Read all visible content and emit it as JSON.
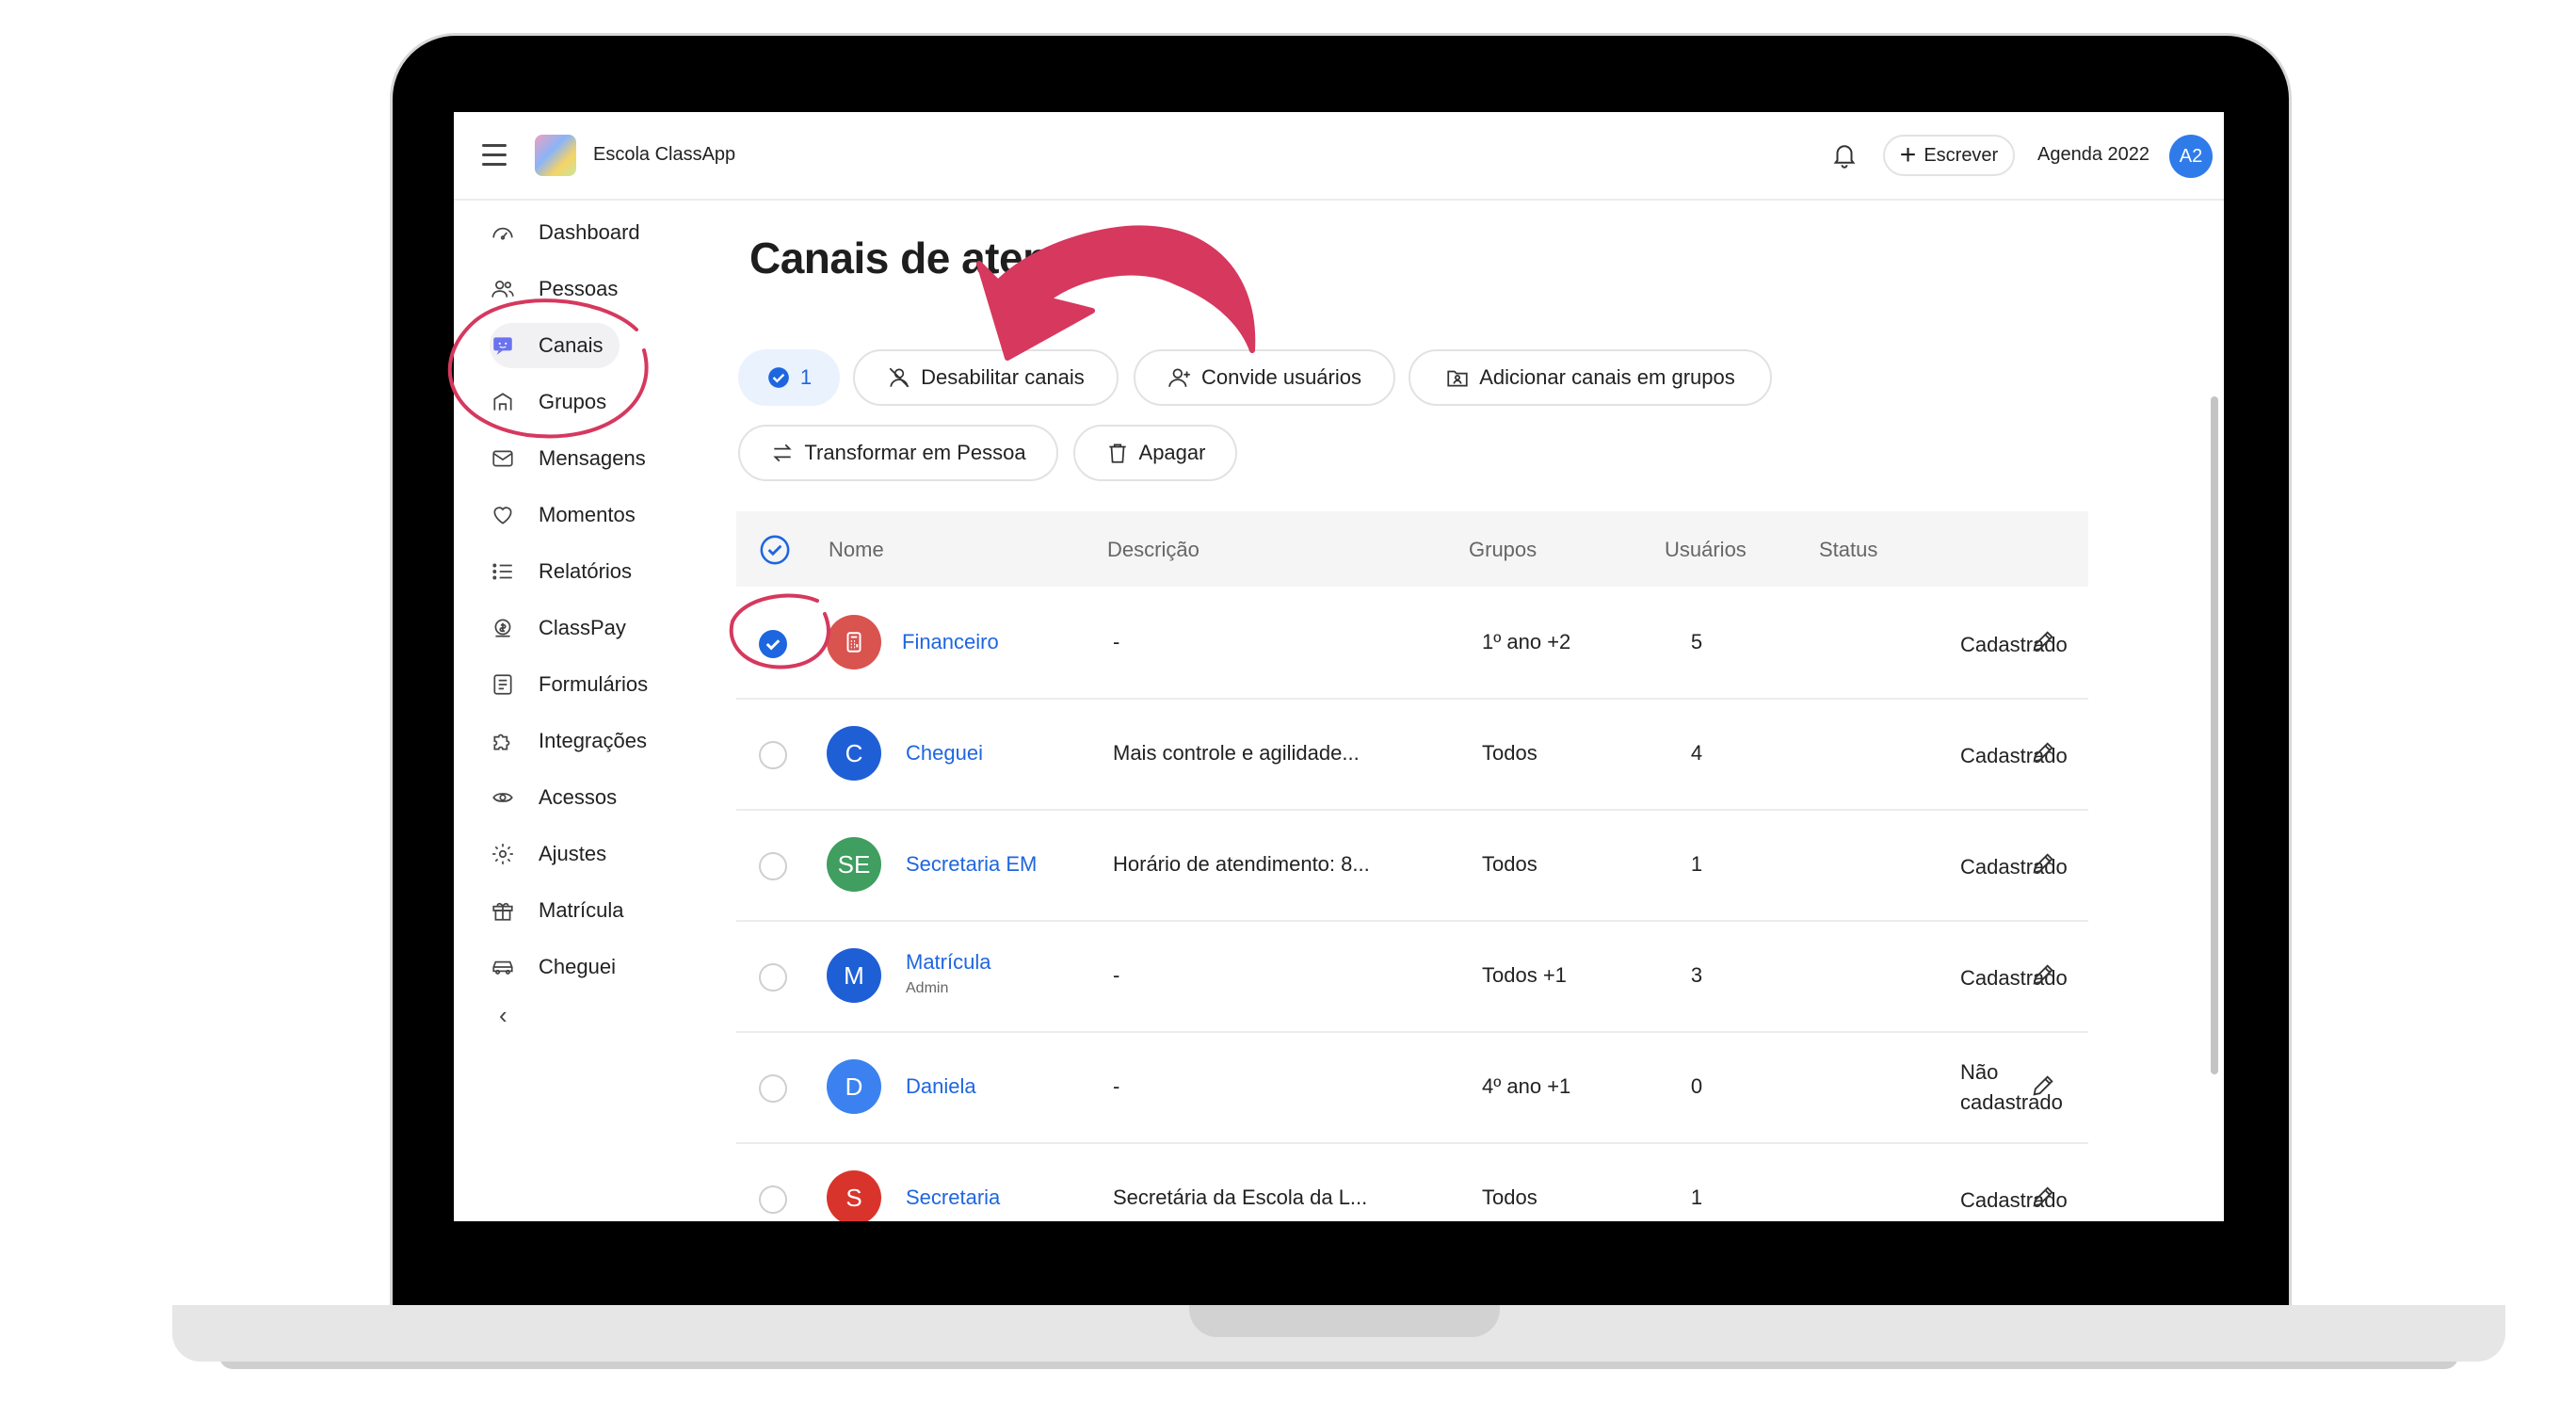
{
  "header": {
    "school_name": "Escola ClassApp",
    "write_label": "Escrever",
    "agenda_label": "Agenda 2022",
    "avatar_initials": "A2"
  },
  "sidebar": {
    "items": [
      {
        "label": "Dashboard",
        "icon": "gauge-icon"
      },
      {
        "label": "Pessoas",
        "icon": "people-icon"
      },
      {
        "label": "Canais",
        "icon": "chat-icon",
        "active": true
      },
      {
        "label": "Grupos",
        "icon": "groups-icon"
      },
      {
        "label": "Mensagens",
        "icon": "envelope-icon"
      },
      {
        "label": "Momentos",
        "icon": "heart-icon"
      },
      {
        "label": "Relatórios",
        "icon": "list-icon"
      },
      {
        "label": "ClassPay",
        "icon": "coin-icon"
      },
      {
        "label": "Formulários",
        "icon": "form-icon"
      },
      {
        "label": "Integrações",
        "icon": "puzzle-icon"
      },
      {
        "label": "Acessos",
        "icon": "key-icon"
      },
      {
        "label": "Ajustes",
        "icon": "gear-icon"
      },
      {
        "label": "Matrícula",
        "icon": "gift-icon"
      },
      {
        "label": "Cheguei",
        "icon": "car-icon"
      }
    ],
    "collapse_label": "‹"
  },
  "page": {
    "title": "Canais de atendimento"
  },
  "toolbar": {
    "selected_count": "1",
    "disable_label": "Desabilitar canais",
    "invite_label": "Convide usuários",
    "add_groups_label": "Adicionar canais em grupos",
    "transform_label": "Transformar em Pessoa",
    "delete_label": "Apagar"
  },
  "table": {
    "headers": {
      "name": "Nome",
      "description": "Descrição",
      "groups": "Grupos",
      "users": "Usuários",
      "status": "Status"
    },
    "rows": [
      {
        "initials": "",
        "color": "#d9534f",
        "name": "Financeiro",
        "sub": "",
        "description": "-",
        "groups": "1º ano +2",
        "users": "5",
        "status": "Cadastrado",
        "checked": true
      },
      {
        "initials": "C",
        "color": "#1f5fd6",
        "name": "Cheguei",
        "sub": "",
        "description": "Mais controle e agilidade...",
        "groups": "Todos",
        "users": "4",
        "status": "Cadastrado",
        "checked": false
      },
      {
        "initials": "SE",
        "color": "#3f9e60",
        "name": "Secretaria EM",
        "sub": "",
        "description": "Horário de atendimento: 8...",
        "groups": "Todos",
        "users": "1",
        "status": "Cadastrado",
        "checked": false
      },
      {
        "initials": "M",
        "color": "#1f5fd6",
        "name": "Matrícula",
        "sub": "Admin",
        "description": "-",
        "groups": "Todos +1",
        "users": "3",
        "status": "Cadastrado",
        "checked": false
      },
      {
        "initials": "D",
        "color": "#3b82f0",
        "name": "Daniela",
        "sub": "",
        "description": "-",
        "groups": "4º ano +1",
        "users": "0",
        "status_line1": "Não",
        "status_line2": "cadastrado",
        "checked": false
      },
      {
        "initials": "S",
        "color": "#d9342b",
        "name": "Secretaria",
        "sub": "",
        "description": "Secretária da Escola da L...",
        "groups": "Todos",
        "users": "1",
        "status": "Cadastrado",
        "checked": false
      }
    ]
  },
  "colors": {
    "accent": "#1e66e0",
    "annotation": "#d6385e"
  }
}
